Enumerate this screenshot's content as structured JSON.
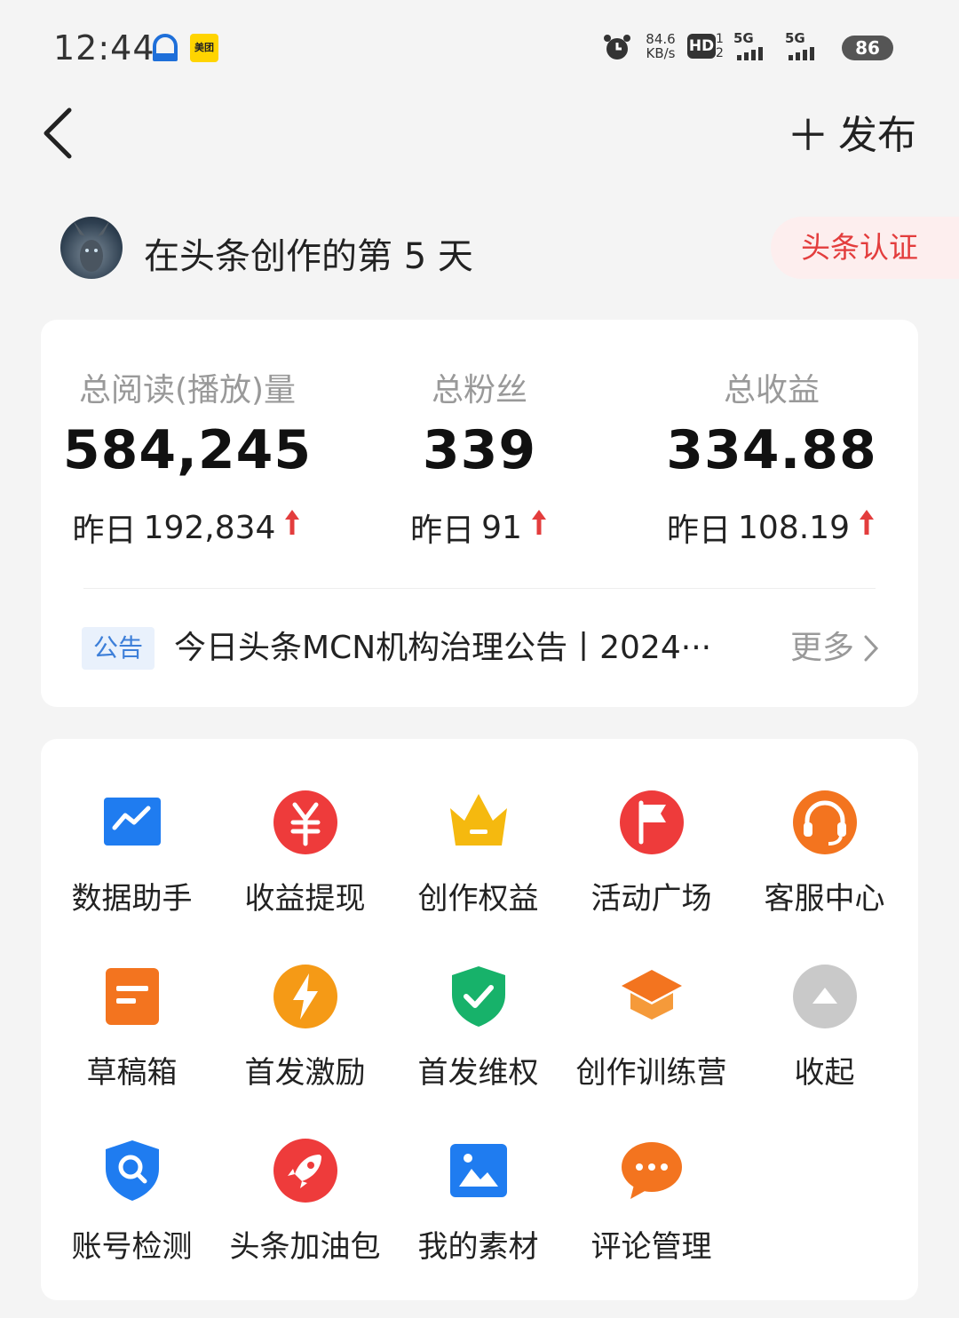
{
  "status_bar": {
    "time": "12:44",
    "app2_label": "美团",
    "speed_value": "84.6",
    "speed_unit": "KB/s",
    "hd_label": "HD",
    "hd_num_top": "1",
    "hd_num_bottom": "2",
    "sim1_label": "5G",
    "sim2_label": "5G",
    "battery": "86"
  },
  "header": {
    "publish_label": "发布"
  },
  "profile": {
    "creator_days_text": "在头条创作的第 5 天",
    "verify_label": "头条认证"
  },
  "stats": [
    {
      "label": "总阅读(播放)量",
      "value": "584,245",
      "yesterday_prefix": "昨日",
      "yesterday_value": "192,834"
    },
    {
      "label": "总粉丝",
      "value": "339",
      "yesterday_prefix": "昨日",
      "yesterday_value": "91"
    },
    {
      "label": "总收益",
      "value": "334.88",
      "yesterday_prefix": "昨日",
      "yesterday_value": "108.19"
    }
  ],
  "notice": {
    "tag": "公告",
    "text": "今日头条MCN机构治理公告丨2024···",
    "more_label": "更多"
  },
  "tools": [
    {
      "label": "数据助手",
      "icon": "chart-icon",
      "color": "#1f7cf0"
    },
    {
      "label": "收益提现",
      "icon": "yuan-icon",
      "color": "#ee3b3b"
    },
    {
      "label": "创作权益",
      "icon": "crown-icon",
      "color": "#f5b90f"
    },
    {
      "label": "活动广场",
      "icon": "flag-icon",
      "color": "#ee3b3b"
    },
    {
      "label": "客服中心",
      "icon": "headset-icon",
      "color": "#f3741f"
    },
    {
      "label": "草稿箱",
      "icon": "draft-icon",
      "color": "#f3741f"
    },
    {
      "label": "首发激励",
      "icon": "lightning-icon",
      "color": "#f59a16"
    },
    {
      "label": "首发维权",
      "icon": "shield-check-icon",
      "color": "#17b26a"
    },
    {
      "label": "创作训练营",
      "icon": "graduation-cap-icon",
      "color": "#f3741f"
    },
    {
      "label": "收起",
      "icon": "collapse-icon",
      "color": "#c9c9c9"
    },
    {
      "label": "账号检测",
      "icon": "shield-search-icon",
      "color": "#1f7cf0"
    },
    {
      "label": "头条加油包",
      "icon": "rocket-icon",
      "color": "#ee3b3b"
    },
    {
      "label": "我的素材",
      "icon": "image-icon",
      "color": "#1f7cf0"
    },
    {
      "label": "评论管理",
      "icon": "comment-icon",
      "color": "#f3741f"
    }
  ]
}
